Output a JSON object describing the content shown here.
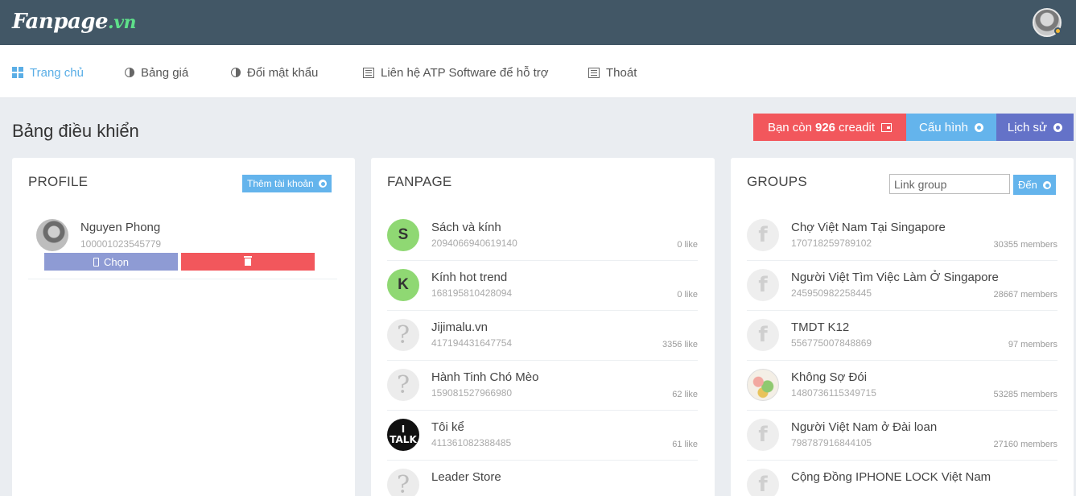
{
  "brand": {
    "name": "Fanpage",
    "suffix": ".vn"
  },
  "nav": [
    {
      "label": "Trang chủ",
      "icon": "dashboard-icon",
      "active": true
    },
    {
      "label": "Bảng giá",
      "icon": "half-circle-icon"
    },
    {
      "label": "Đổi mật khẩu",
      "icon": "half-circle-icon"
    },
    {
      "label": "Liên hệ ATP Software để hỗ trợ",
      "icon": "document-icon"
    },
    {
      "label": "Thoát",
      "icon": "document-icon"
    }
  ],
  "page": {
    "title": "Bảng điều khiển",
    "credit": {
      "prefix": "Bạn còn",
      "value": "926",
      "suffix": "creadit"
    },
    "config_label": "Cấu hình",
    "history_label": "Lịch sử"
  },
  "profile": {
    "title": "PROFILE",
    "add_label": "Thêm tài khoản",
    "user": {
      "name": "Nguyen Phong",
      "id": "100001023545779"
    },
    "select_label": "Chọn"
  },
  "fanpage": {
    "title": "FANPAGE",
    "items": [
      {
        "name": "Sách và kính",
        "id": "2094066940619140",
        "meta": "0 like",
        "avatar": "S"
      },
      {
        "name": "Kính hot trend",
        "id": "168195810428094",
        "meta": "0 like",
        "avatar": "K"
      },
      {
        "name": "Jijimalu.vn",
        "id": "417194431647754",
        "meta": "3356 like",
        "avatar": "?"
      },
      {
        "name": "Hành Tinh Chó Mèo",
        "id": "159081527966980",
        "meta": "62 like",
        "avatar": "?"
      },
      {
        "name": "Tôi kể",
        "id": "411361082388485",
        "meta": "61 like",
        "avatar": "I TALK"
      },
      {
        "name": "Leader Store",
        "id": "",
        "meta": "",
        "avatar": "?"
      }
    ]
  },
  "groups": {
    "title": "GROUPS",
    "link_placeholder": "Link group",
    "go_label": "Đến",
    "items": [
      {
        "name": "Chợ Việt Nam Tại Singapore",
        "id": "170718259789102",
        "meta": "30355 members",
        "avatar": "f"
      },
      {
        "name": "Người Việt Tìm Việc Làm Ở Singapore",
        "id": "245950982258445",
        "meta": "28667 members",
        "avatar": "f"
      },
      {
        "name": "TMDT K12",
        "id": "556775007848869",
        "meta": "97 members",
        "avatar": "f"
      },
      {
        "name": "Không Sợ Đói",
        "id": "1480736115349715",
        "meta": "53285 members",
        "avatar": ""
      },
      {
        "name": "Người Việt Nam ở Đài loan",
        "id": "798787916844105",
        "meta": "27160 members",
        "avatar": "f"
      },
      {
        "name": "Cộng Đồng IPHONE LOCK Việt Nam",
        "id": "",
        "meta": "",
        "avatar": "f"
      }
    ]
  }
}
